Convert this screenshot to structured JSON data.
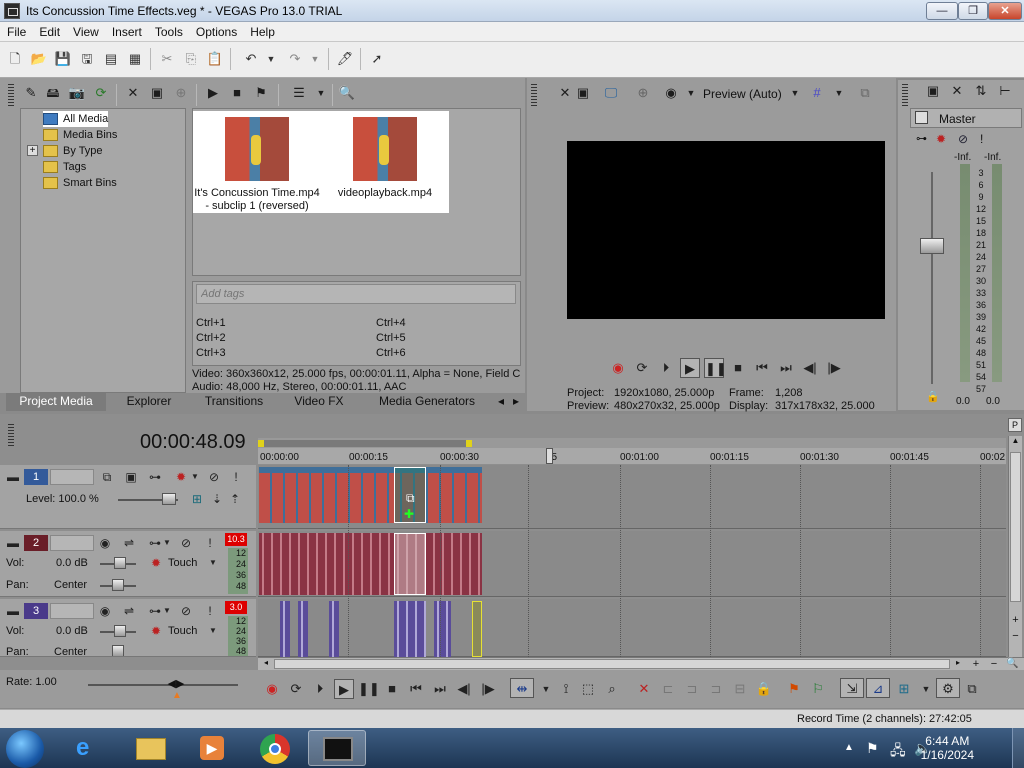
{
  "window": {
    "title": "Its Concussion Time Effects.veg * - VEGAS Pro 13.0 TRIAL",
    "minimize": "—",
    "maximize": "❐",
    "close": "✕"
  },
  "menu": [
    "File",
    "Edit",
    "View",
    "Insert",
    "Tools",
    "Options",
    "Help"
  ],
  "explorer": {
    "tree": [
      {
        "label": "All Media",
        "expander": ""
      },
      {
        "label": "Media Bins",
        "expander": ""
      },
      {
        "label": "By Type",
        "expander": "+"
      },
      {
        "label": "Tags",
        "expander": ""
      },
      {
        "label": "Smart Bins",
        "expander": ""
      }
    ],
    "media": [
      {
        "line1": "It's Concussion Time.mp4",
        "line2": "- subclip 1 (reversed)"
      },
      {
        "line1": "videoplayback.mp4",
        "line2": ""
      }
    ],
    "tag_placeholder": "Add tags",
    "shortcuts": [
      "Ctrl+1",
      "Ctrl+2",
      "Ctrl+3",
      "Ctrl+4",
      "Ctrl+5",
      "Ctrl+6"
    ],
    "info_video": "Video: 360x360x12, 25.000 fps, 00:00:01.11, Alpha = None, Field C",
    "info_audio": "Audio: 48,000 Hz, Stereo, 00:00:01.11, AAC",
    "tabs": [
      "Project Media",
      "Explorer",
      "Transitions",
      "Video FX",
      "Media Generators"
    ]
  },
  "preview": {
    "mode_label": "Preview (Auto)",
    "project_label": "Project:",
    "project_value": "1920x1080, 25.000p",
    "frame_label": "Frame:",
    "frame_value": "1,208",
    "preview_label": "Preview:",
    "preview_value": "480x270x32, 25.000p",
    "display_label": "Display:",
    "display_value": "317x178x32, 25.000"
  },
  "mixer": {
    "title": "Master",
    "left_inf": "-Inf.",
    "right_inf": "-Inf.",
    "scale": [
      "3",
      "6",
      "9",
      "12",
      "15",
      "18",
      "21",
      "24",
      "27",
      "30",
      "33",
      "36",
      "39",
      "42",
      "45",
      "48",
      "51",
      "54",
      "57"
    ],
    "left_val": "0.0",
    "right_val": "0.0"
  },
  "timeline": {
    "timecode": "00:00:48.09",
    "ruler": [
      "00:00:00",
      "00:00:15",
      "00:00:30",
      "45",
      "00:01:00",
      "00:01:15",
      "00:01:30",
      "00:01:45",
      "00:02"
    ],
    "tracks": [
      {
        "num": "1",
        "type": "video",
        "level_label": "Level: 100.0 %"
      },
      {
        "num": "2",
        "type": "audio",
        "vol_label": "Vol:",
        "vol_value": "0.0 dB",
        "pan_label": "Pan:",
        "pan_value": "Center",
        "mode": "Touch",
        "peak": "10.3",
        "meter": [
          "12",
          "24",
          "36",
          "48"
        ]
      },
      {
        "num": "3",
        "type": "audio",
        "vol_label": "Vol:",
        "vol_value": "0.0 dB",
        "pan_label": "Pan:",
        "pan_value": "Center",
        "mode": "Touch",
        "peak": "3.0",
        "meter": [
          "12",
          "24",
          "36",
          "48"
        ]
      }
    ],
    "rate_label": "Rate: 1.00",
    "record_time": "Record Time (2 channels): 27:42:05"
  },
  "taskbar": {
    "time": "6:44 AM",
    "date": "1/16/2024"
  }
}
